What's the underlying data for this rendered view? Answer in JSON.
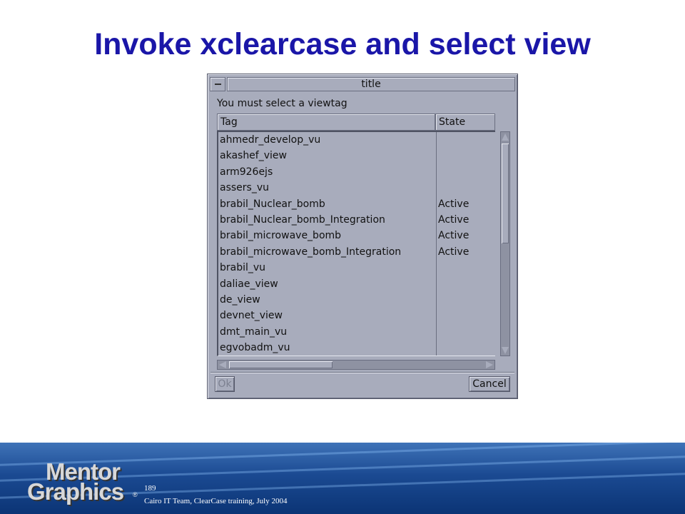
{
  "slide": {
    "title": "Invoke xclearcase and select view"
  },
  "dialog": {
    "title": "title",
    "prompt": "You must select a viewtag",
    "columns": [
      "Tag",
      "State"
    ],
    "rows": [
      {
        "tag": "ahmedr_develop_vu",
        "state": ""
      },
      {
        "tag": "akashef_view",
        "state": ""
      },
      {
        "tag": "arm926ejs",
        "state": ""
      },
      {
        "tag": "assers_vu",
        "state": ""
      },
      {
        "tag": "brabil_Nuclear_bomb",
        "state": "Active"
      },
      {
        "tag": "brabil_Nuclear_bomb_Integration",
        "state": "Active"
      },
      {
        "tag": "brabil_microwave_bomb",
        "state": "Active"
      },
      {
        "tag": "brabil_microwave_bomb_Integration",
        "state": "Active"
      },
      {
        "tag": "brabil_vu",
        "state": ""
      },
      {
        "tag": "daliae_view",
        "state": ""
      },
      {
        "tag": "de_view",
        "state": ""
      },
      {
        "tag": "devnet_view",
        "state": ""
      },
      {
        "tag": "dmt_main_vu",
        "state": ""
      },
      {
        "tag": "egvobadm_vu",
        "state": ""
      }
    ],
    "ok_label": "Ok",
    "cancel_label": "Cancel"
  },
  "footer": {
    "logo_line1": "Mentor",
    "logo_line2": "Graphics",
    "logo_reg": "®",
    "page_number": "189",
    "text": "Cairo IT Team, ClearCase training, July 2004"
  },
  "colors": {
    "title": "#1a16a8",
    "dialog_bg": "#a8acbc",
    "footer_bg": "#1b4a92"
  }
}
